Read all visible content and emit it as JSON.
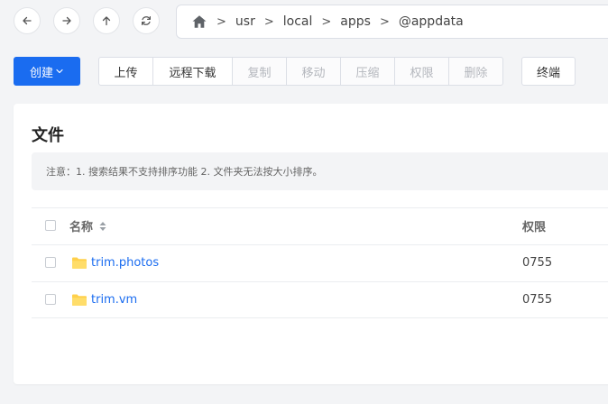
{
  "nav": {
    "back_icon": "arrow-left-icon",
    "forward_icon": "arrow-right-icon",
    "up_icon": "arrow-up-icon",
    "refresh_icon": "refresh-icon"
  },
  "breadcrumb": {
    "home_icon": "home-icon",
    "separator": ">",
    "items": [
      "usr",
      "local",
      "apps",
      "@appdata"
    ]
  },
  "toolbar": {
    "create_label": "创建",
    "upload_label": "上传",
    "remote_download_label": "远程下载",
    "copy_label": "复制",
    "move_label": "移动",
    "compress_label": "压缩",
    "permission_label": "权限",
    "delete_label": "删除",
    "terminal_label": "终端"
  },
  "files": {
    "title": "文件",
    "notice": "注意：1. 搜索结果不支持排序功能 2. 文件夹无法按大小排序。",
    "columns": {
      "name": "名称",
      "permission": "权限"
    },
    "rows": [
      {
        "name": "trim.photos",
        "permission": "0755",
        "icon": "folder-icon"
      },
      {
        "name": "trim.vm",
        "permission": "0755",
        "icon": "folder-icon"
      }
    ]
  },
  "colors": {
    "accent": "#1a6cf0",
    "folder": "#ffd04b",
    "background": "#f3f4f6"
  }
}
